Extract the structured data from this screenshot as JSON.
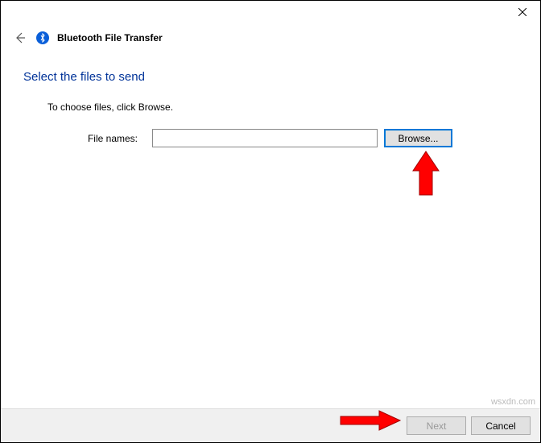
{
  "window": {
    "title": "Bluetooth File Transfer"
  },
  "page": {
    "heading": "Select the files to send",
    "instruction": "To choose files, click Browse.",
    "file_label": "File names:",
    "file_value": "",
    "browse_label": "Browse..."
  },
  "footer": {
    "next_label": "Next",
    "cancel_label": "Cancel"
  },
  "watermark": "wsxdn.com"
}
